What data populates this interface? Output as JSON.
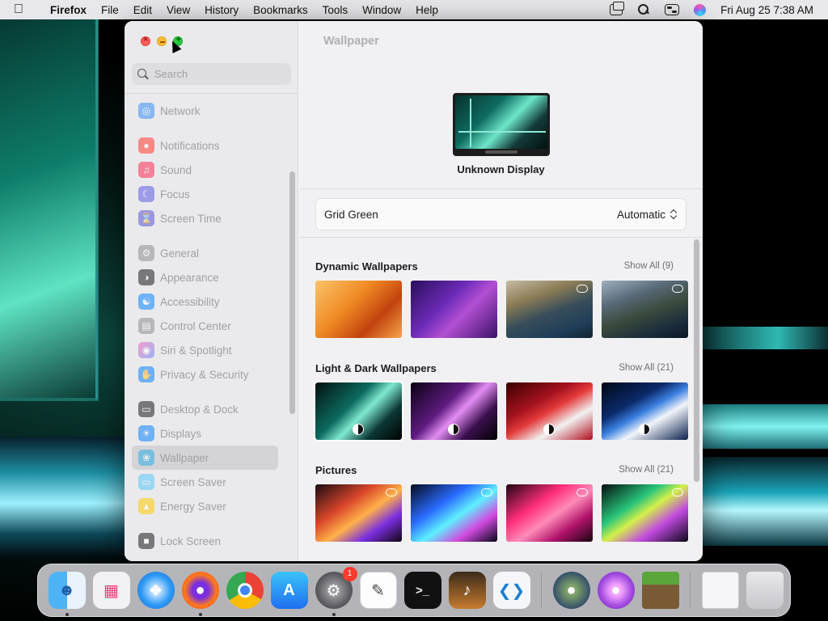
{
  "menubar": {
    "app_name": "Firefox",
    "menus": [
      "File",
      "Edit",
      "View",
      "History",
      "Bookmarks",
      "Tools",
      "Window",
      "Help"
    ],
    "clock": "Fri Aug 25  7:38 AM"
  },
  "sidebar": {
    "search_placeholder": "Search",
    "items": [
      {
        "label": "Network",
        "icon": "network-icon",
        "color": "#3a8ef6"
      },
      {
        "label": "Notifications",
        "icon": "notifications-icon",
        "color": "#ff3b30"
      },
      {
        "label": "Sound",
        "icon": "sound-icon",
        "color": "#ff2d55"
      },
      {
        "label": "Focus",
        "icon": "focus-icon",
        "color": "#5e5ce6"
      },
      {
        "label": "Screen Time",
        "icon": "screen-time-icon",
        "color": "#5856d6"
      },
      {
        "label": "General",
        "icon": "general-icon",
        "color": "#8e8e93"
      },
      {
        "label": "Appearance",
        "icon": "appearance-icon",
        "color": "#1c1c1e"
      },
      {
        "label": "Accessibility",
        "icon": "accessibility-icon",
        "color": "#0a84ff"
      },
      {
        "label": "Control Center",
        "icon": "control-center-icon",
        "color": "#8e8e93"
      },
      {
        "label": "Siri & Spotlight",
        "icon": "siri-icon",
        "color": "#af52de"
      },
      {
        "label": "Privacy & Security",
        "icon": "privacy-icon",
        "color": "#0a84ff"
      },
      {
        "label": "Desktop & Dock",
        "icon": "desktop-dock-icon",
        "color": "#1c1c1e"
      },
      {
        "label": "Displays",
        "icon": "displays-icon",
        "color": "#0a84ff"
      },
      {
        "label": "Wallpaper",
        "icon": "wallpaper-icon",
        "color": "#32ade6"
      },
      {
        "label": "Screen Saver",
        "icon": "screen-saver-icon",
        "color": "#5ac8fa"
      },
      {
        "label": "Energy Saver",
        "icon": "energy-saver-icon",
        "color": "#ffcc00"
      },
      {
        "label": "Lock Screen",
        "icon": "lock-screen-icon",
        "color": "#1c1c1e"
      }
    ],
    "selected": "Wallpaper"
  },
  "main": {
    "title": "Wallpaper",
    "display_name": "Unknown Display",
    "current_wallpaper": "Grid Green",
    "mode": "Automatic",
    "sections": [
      {
        "title": "Dynamic Wallpapers",
        "show_all": "Show All (9)",
        "thumbs": [
          {
            "name": "ventura-orange",
            "badge": ""
          },
          {
            "name": "monterey-purple",
            "badge": ""
          },
          {
            "name": "catalina-coast-day",
            "badge": "cloud"
          },
          {
            "name": "catalina-coast-evening",
            "badge": "cloud"
          }
        ]
      },
      {
        "title": "Light & Dark Wallpapers",
        "show_all": "Show All (21)",
        "thumbs": [
          {
            "name": "grid-green",
            "badge": "half"
          },
          {
            "name": "grid-purple",
            "badge": "half"
          },
          {
            "name": "ventura-red",
            "badge": "half"
          },
          {
            "name": "ventura-blue",
            "badge": "half"
          }
        ]
      },
      {
        "title": "Pictures",
        "show_all": "Show All (21)",
        "thumbs": [
          {
            "name": "macbook-orange-swirl",
            "badge": "cloud"
          },
          {
            "name": "macbook-blue-swirl",
            "badge": "cloud"
          },
          {
            "name": "macbook-pink-swirl",
            "badge": "cloud"
          },
          {
            "name": "macbook-green-swirl",
            "badge": "cloud"
          }
        ]
      }
    ]
  },
  "dock": {
    "apps": [
      {
        "name": "Finder",
        "icon": "finder-icon",
        "running": true
      },
      {
        "name": "Launchpad",
        "icon": "launchpad-icon",
        "running": false
      },
      {
        "name": "Safari",
        "icon": "safari-icon",
        "running": false
      },
      {
        "name": "Firefox",
        "icon": "firefox-icon",
        "running": true
      },
      {
        "name": "Chrome",
        "icon": "chrome-icon",
        "running": false
      },
      {
        "name": "App Store",
        "icon": "app-store-icon",
        "running": false
      },
      {
        "name": "System Settings",
        "icon": "system-settings-icon",
        "running": true,
        "badge": "1"
      },
      {
        "name": "TextEdit",
        "icon": "textedit-icon",
        "running": false
      },
      {
        "name": "Terminal",
        "icon": "terminal-icon",
        "running": false
      },
      {
        "name": "GarageBand",
        "icon": "garageband-icon",
        "running": false
      },
      {
        "name": "VS Code",
        "icon": "vscode-icon",
        "running": false
      }
    ],
    "extras": [
      {
        "name": "Installer Disk 1",
        "icon": "installer-disk-icon"
      },
      {
        "name": "Installer Disk 2",
        "icon": "installer-disk-icon"
      },
      {
        "name": "Minecraft",
        "icon": "minecraft-icon"
      }
    ],
    "trailing": [
      {
        "name": "Downloads",
        "icon": "downloads-stack-icon"
      },
      {
        "name": "Trash",
        "icon": "trash-icon"
      }
    ]
  }
}
